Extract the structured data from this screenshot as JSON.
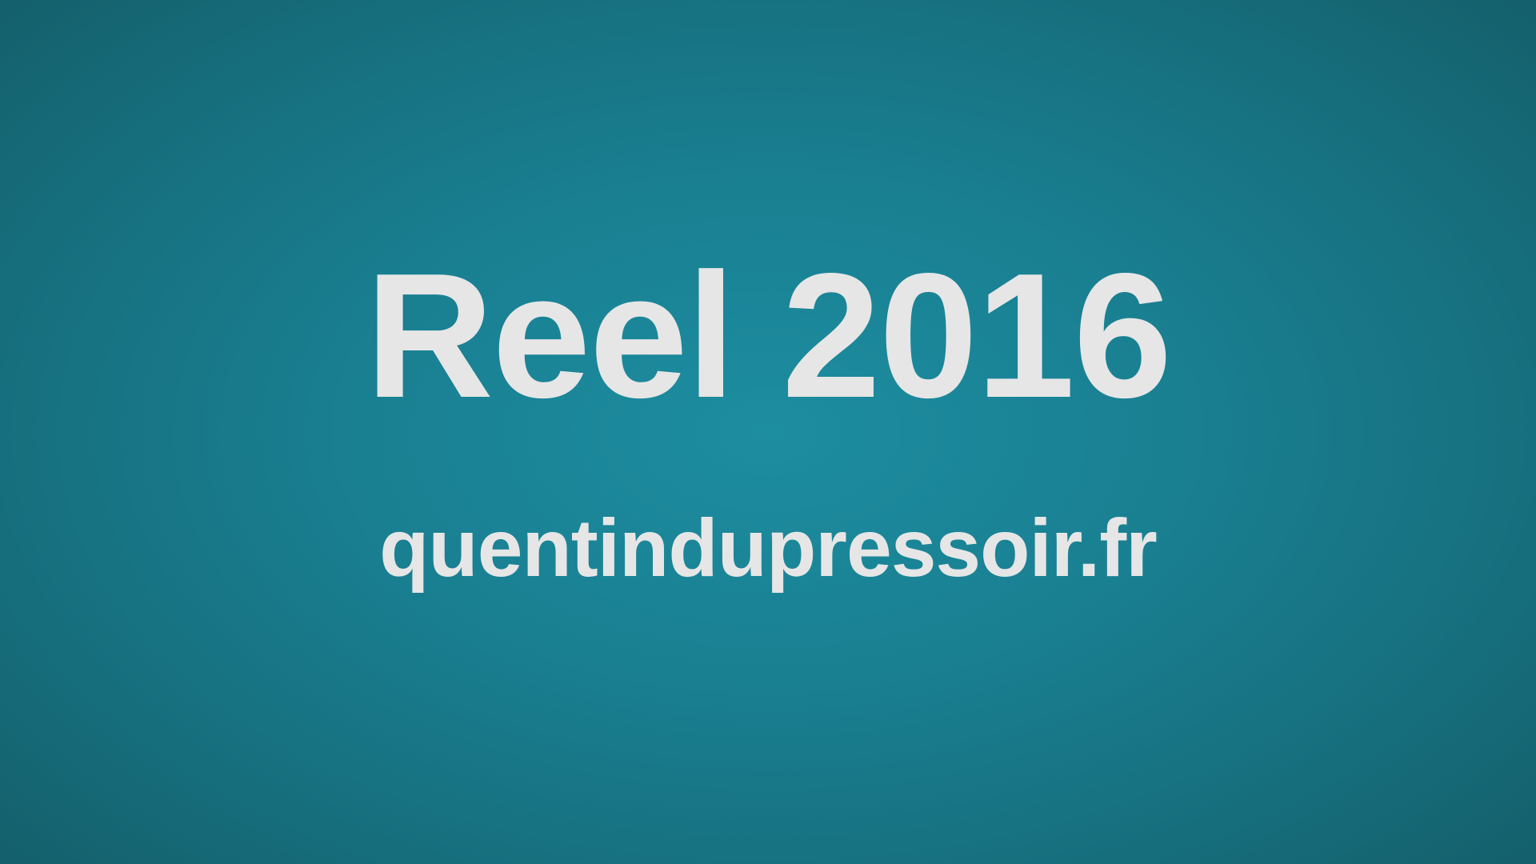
{
  "title": "Reel 2016",
  "url": "quentindupressoir.fr",
  "colors": {
    "background_center": "#1d8da0",
    "background_edge": "#145e6a",
    "text": "#e6e6e6"
  }
}
